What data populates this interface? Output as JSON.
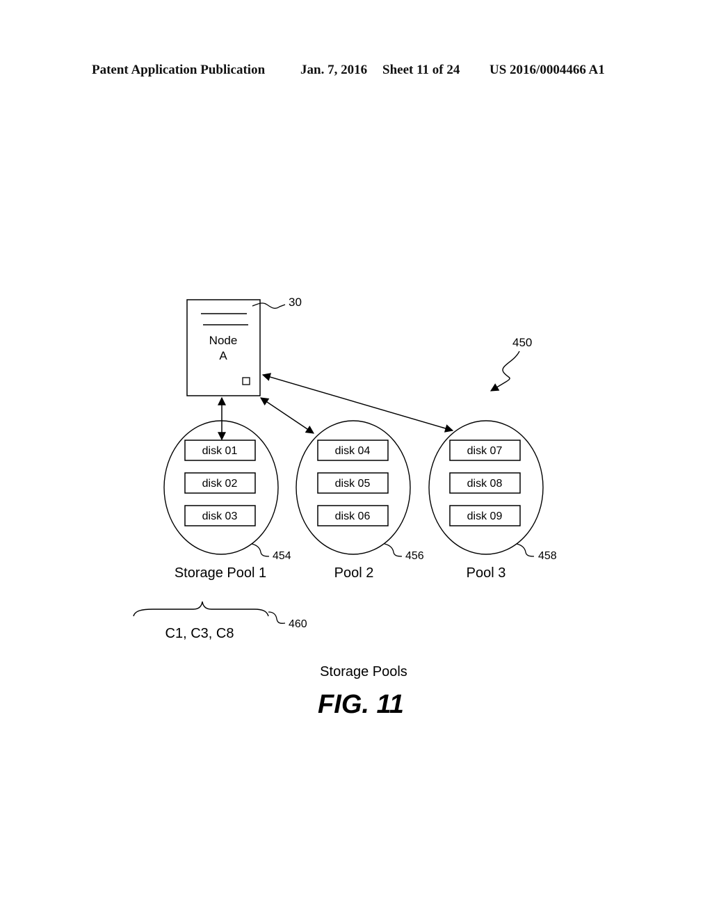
{
  "header": {
    "publication": "Patent Application Publication",
    "date": "Jan. 7, 2016",
    "sheet": "Sheet 11 of 24",
    "number": "US 2016/0004466 A1"
  },
  "node": {
    "label_line1": "Node",
    "label_line2": "A",
    "ref": "30"
  },
  "system_ref": "450",
  "pools": [
    {
      "name": "Storage Pool 1",
      "ref": "454",
      "disks": [
        "disk 01",
        "disk 02",
        "disk 03"
      ]
    },
    {
      "name": "Pool 2",
      "ref": "456",
      "disks": [
        "disk 04",
        "disk 05",
        "disk 06"
      ]
    },
    {
      "name": "Pool 3",
      "ref": "458",
      "disks": [
        "disk 07",
        "disk 08",
        "disk 09"
      ]
    }
  ],
  "brace": {
    "label": "C1, C3, C8",
    "ref": "460"
  },
  "caption": "Storage Pools",
  "figure_label": "FIG. 11"
}
